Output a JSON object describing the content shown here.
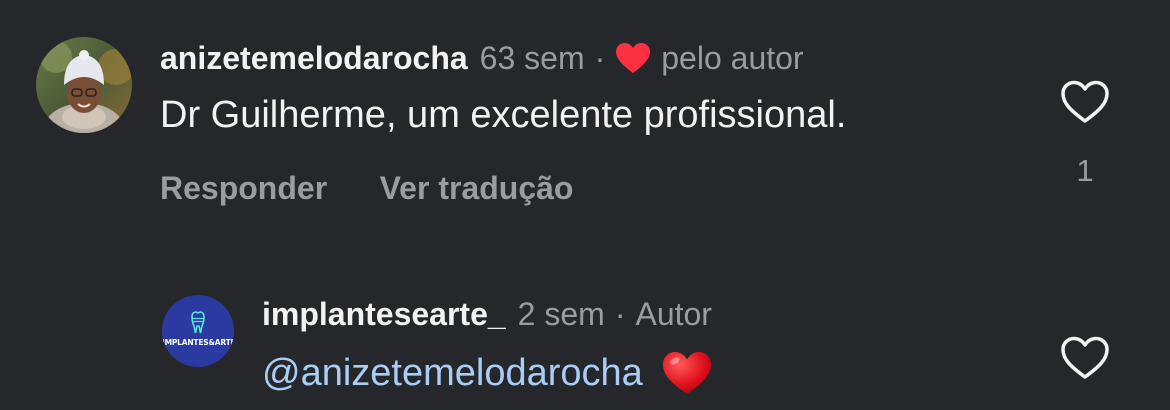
{
  "comments": [
    {
      "username": "anizetemelodarocha",
      "time": "63 sem",
      "separator": "·",
      "liked_by_author_label": "pelo autor",
      "text": "Dr Guilherme, um excelente profissional.",
      "actions": {
        "reply": "Responder",
        "translate": "Ver tradução"
      },
      "like_count": "1",
      "avatar_icon": "user-photo-avatar"
    },
    {
      "username": "implantesearte_",
      "time": "2 sem",
      "separator": "·",
      "author_badge": "Autor",
      "mention": "@anizetemelodarocha",
      "emoji": "❤️",
      "avatar_logo_text": "IMPLANTES&ARTE",
      "avatar_icon": "tooth-logo-avatar"
    }
  ],
  "colors": {
    "background": "#25272b",
    "primary_text": "#f2f2f2",
    "secondary_text": "#9b9ca1",
    "mention": "#a9cdf7",
    "heart_red": "#ff3040",
    "logo_bg": "#2a3aa0"
  },
  "icons": {
    "like": "heart-outline-icon",
    "author_like": "heart-filled-icon"
  }
}
